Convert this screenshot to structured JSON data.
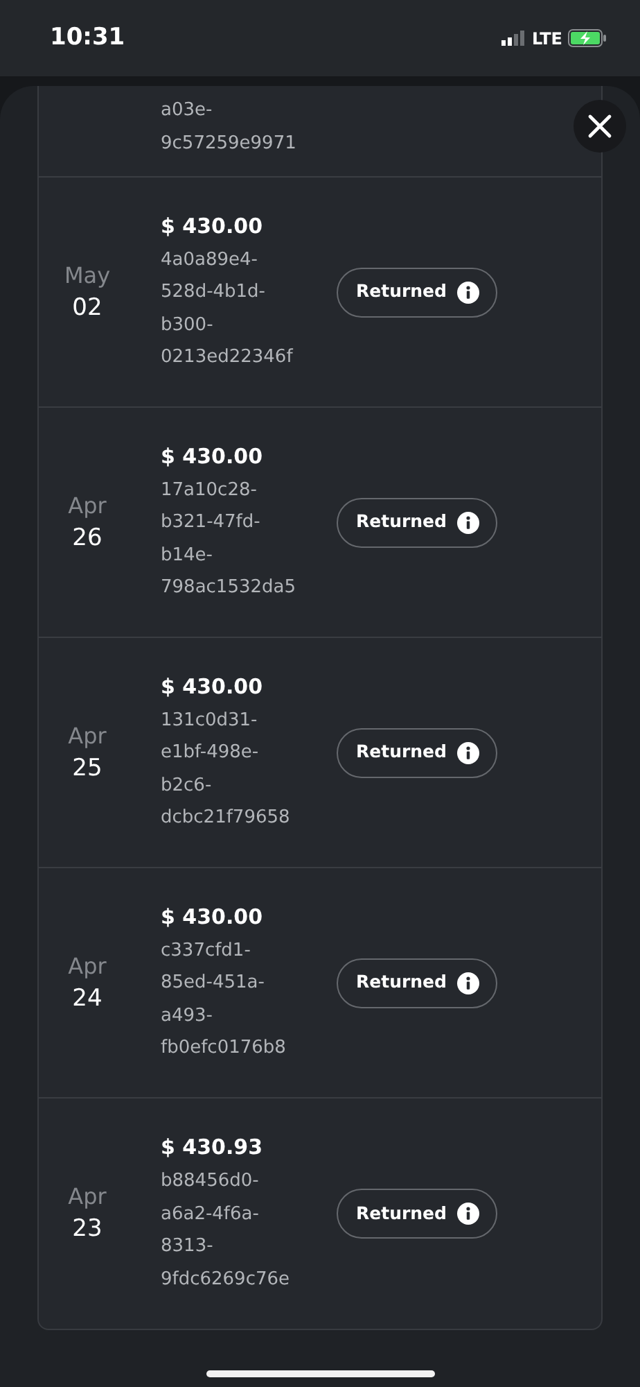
{
  "status_bar": {
    "time": "10:31",
    "network": "LTE"
  },
  "top_cut_row": {
    "id_lines": [
      "a03e-",
      "9c57259e9971"
    ]
  },
  "transactions": [
    {
      "month": "May",
      "day": "02",
      "amount": "$ 430.00",
      "id_lines": [
        "4a0a89e4-",
        "528d-4b1d-",
        "b300-",
        "0213ed22346f"
      ],
      "status": "Returned"
    },
    {
      "month": "Apr",
      "day": "26",
      "amount": "$ 430.00",
      "id_lines": [
        "17a10c28-",
        "b321-47fd-",
        "b14e-",
        "798ac1532da5"
      ],
      "status": "Returned"
    },
    {
      "month": "Apr",
      "day": "25",
      "amount": "$ 430.00",
      "id_lines": [
        "131c0d31-",
        "e1bf-498e-",
        "b2c6-",
        "dcbc21f79658"
      ],
      "status": "Returned"
    },
    {
      "month": "Apr",
      "day": "24",
      "amount": "$ 430.00",
      "id_lines": [
        "c337cfd1-",
        "85ed-451a-",
        "a493-",
        "fb0efc0176b8"
      ],
      "status": "Returned"
    },
    {
      "month": "Apr",
      "day": "23",
      "amount": "$ 430.93",
      "id_lines": [
        "b88456d0-",
        "a6a2-4f6a-",
        "8313-",
        "9fdc6269c76e"
      ],
      "status": "Returned"
    }
  ]
}
